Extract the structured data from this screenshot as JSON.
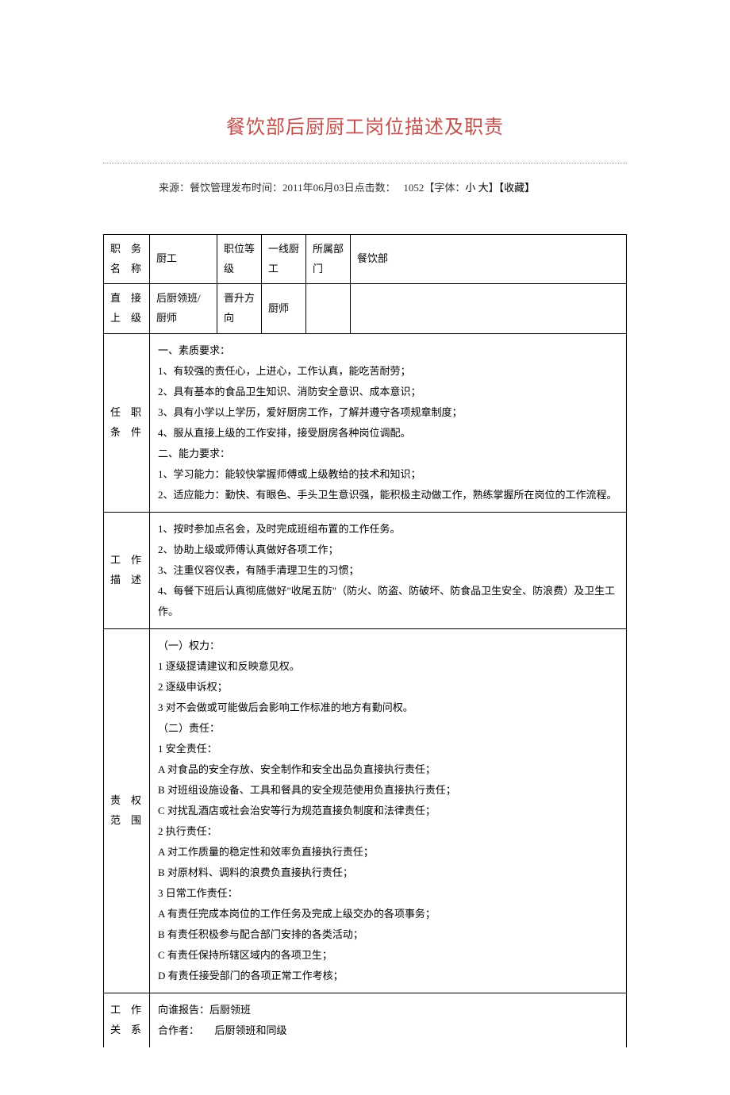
{
  "title": "餐饮部后厨厨工岗位描述及职责",
  "meta": {
    "source_label": "来源：",
    "source_value": "餐饮管理",
    "publish_label": "发布时间：",
    "publish_value": "2011年06月03日",
    "hits_label": "点击数：",
    "hits_value": "1052",
    "font_label": "【字体：",
    "font_small": "小",
    "font_large": "大",
    "font_close": "】",
    "collect": "【收藏】"
  },
  "row1": {
    "label1": "职务名称",
    "val1": "厨工",
    "label2": "职位等级",
    "val2": "一线厨工",
    "label3": "所属部门",
    "val3": "餐饮部"
  },
  "row2": {
    "label1": "直接上级",
    "val1": "后厨领班/厨师",
    "label2": "晋升方向",
    "val2": "厨师"
  },
  "row3": {
    "label": "任职条件",
    "l1": "一、素质要求：",
    "l2": "1、有较强的责任心，上进心，工作认真，能吃苦耐劳；",
    "l3": "2、具有基本的食品卫生知识、消防安全意识、成本意识；",
    "l4": "3、具有小学以上学历，爱好厨房工作，了解并遵守各项规章制度；",
    "l5": "4、服从直接上级的工作安排，接受厨房各种岗位调配。",
    "l6": "二、能力要求：",
    "l7": "1、学习能力：能较快掌握师傅或上级教给的技术和知识；",
    "l8": "2、适应能力：勤快、有眼色、手头卫生意识强，能积极主动做工作，熟练掌握所在岗位的工作流程。"
  },
  "row4": {
    "label": "工作描述",
    "l1": "1、按时参加点名会，及时完成班组布置的工作任务。",
    "l2": "2、协助上级或师傅认真做好各项工作；",
    "l3": "3、注重仪容仪表，有随手清理卫生的习惯；",
    "l4": "4、每餐下班后认真彻底做好\"收尾五防\"（防火、防盗、防破坏、防食品卫生安全、防浪费）及卫生工作。"
  },
  "row5": {
    "label": "责权范围",
    "l1": "（一）权力：",
    "l2": "1 逐级提请建议和反映意见权。",
    "l3": "2 逐级申诉权；",
    "l4": "3 对不会做或可能做后会影响工作标准的地方有勤问权。",
    "l5": "（二）责任：",
    "l6": "1 安全责任：",
    "l7": "A 对食品的安全存放、安全制作和安全出品负直接执行责任；",
    "l8": "B 对班组设施设备、工具和餐具的安全规范使用负直接执行责任；",
    "l9": "C 对扰乱酒店或社会治安等行为规范直接负制度和法律责任；",
    "l10": "2 执行责任：",
    "l11": "A 对工作质量的稳定性和效率负直接执行责任；",
    "l12": "B 对原材料、调料的浪费负直接执行责任；",
    "l13": "3 日常工作责任：",
    "l14": "A 有责任完成本岗位的工作任务及完成上级交办的各项事务；",
    "l15": "B 有责任积极参与配合部门安排的各类活动；",
    "l16": "C 有责任保持所辖区域内的各项卫生；",
    "l17": "D 有责任接受部门的各项正常工作考核；"
  },
  "row6": {
    "label": "工作关系",
    "l1": "向谁报告：后厨领班",
    "l2": "合作者：　　后厨领班和同级"
  }
}
